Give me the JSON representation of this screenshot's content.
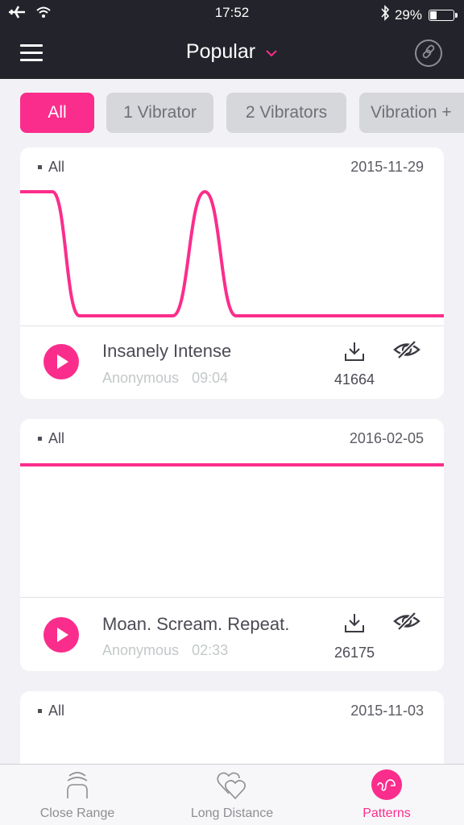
{
  "status_bar": {
    "time": "17:52",
    "battery_percent": "29%",
    "battery_level": 0.29,
    "icons": [
      "airplane-icon",
      "wifi-icon",
      "bluetooth-icon",
      "battery-icon"
    ]
  },
  "navbar": {
    "title": "Popular",
    "menu_icon": "hamburger-icon",
    "dropdown_icon": "chevron-down-icon",
    "right_icon": "link-icon"
  },
  "filters": [
    {
      "label": "All",
      "active": true
    },
    {
      "label": "1 Vibrator",
      "active": false
    },
    {
      "label": "2 Vibrators",
      "active": false
    },
    {
      "label": "Vibration +",
      "active": false
    }
  ],
  "accent_color": "#fb2d8c",
  "patterns": [
    {
      "tag": "All",
      "date": "2015-11-29",
      "title": "Insanely Intense",
      "author": "Anonymous",
      "duration": "09:04",
      "downloads": "41664",
      "waveform": [
        [
          0,
          1
        ],
        [
          0.076,
          1
        ],
        [
          0.14,
          0
        ],
        [
          0.36,
          0
        ],
        [
          0.436,
          1
        ],
        [
          0.51,
          0
        ],
        [
          1,
          0
        ]
      ]
    },
    {
      "tag": "All",
      "date": "2016-02-05",
      "title": "Moan. Scream. Repeat.",
      "author": "Anonymous",
      "duration": "02:33",
      "downloads": "26175",
      "waveform": [
        [
          0,
          1
        ],
        [
          1,
          1
        ]
      ]
    },
    {
      "tag": "All",
      "date": "2015-11-03"
    }
  ],
  "tabbar": [
    {
      "label": "Close Range",
      "icon": "close-range-icon",
      "active": false
    },
    {
      "label": "Long Distance",
      "icon": "hearts-icon",
      "active": false
    },
    {
      "label": "Patterns",
      "icon": "pattern-wave-icon",
      "active": true
    }
  ]
}
